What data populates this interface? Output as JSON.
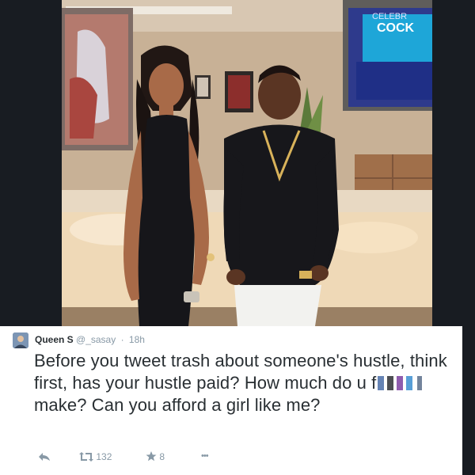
{
  "tweet": {
    "display_name": "Queen S",
    "handle": "@_sasay",
    "separator": "·",
    "time": "18h",
    "text_part1": "Before you tweet trash about someone's hustle, think first, has your hustle paid? How much do u f",
    "text_part2": " make? Can you afford a girl like me?",
    "retweet_count": "132",
    "favorite_count": "8",
    "more_label": "•••"
  },
  "photo": {
    "tv_text_line1": "CELEBR",
    "tv_text_line2": "COCK"
  },
  "colors": {
    "tweet_text": "#292f33",
    "meta_text": "#8899a6",
    "dark_background": "#181c22"
  },
  "icons": [
    "reply-icon",
    "retweet-icon",
    "favorite-icon",
    "more-icon"
  ]
}
